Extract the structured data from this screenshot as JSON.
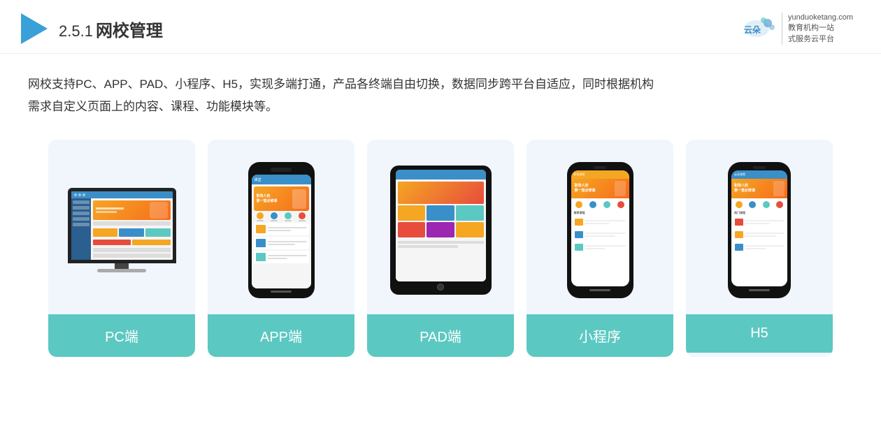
{
  "header": {
    "title_number": "2.5.1",
    "title_main": "网校管理",
    "logo_site": "yunduoketang.com",
    "logo_tagline1": "教育机构一站",
    "logo_tagline2": "式服务云平台"
  },
  "description": {
    "line1": "网校支持PC、APP、PAD、小程序、H5，实现多端打通，产品各终端自由切换，数据同步跨平台自适应，同时根据机构",
    "line2": "需求自定义页面上的内容、课程、功能模块等。"
  },
  "cards": [
    {
      "id": "pc",
      "label": "PC端"
    },
    {
      "id": "app",
      "label": "APP端"
    },
    {
      "id": "pad",
      "label": "PAD端"
    },
    {
      "id": "mini",
      "label": "小程序"
    },
    {
      "id": "h5",
      "label": "H5"
    }
  ],
  "colors": {
    "accent": "#5cc8c2",
    "teal": "#5cc8c2",
    "orange": "#f5a623",
    "blue_dark": "#2a5f8f",
    "blue_mid": "#3a8fc8",
    "red": "#e84c3d",
    "green": "#4caf50",
    "purple": "#9c27b0"
  }
}
